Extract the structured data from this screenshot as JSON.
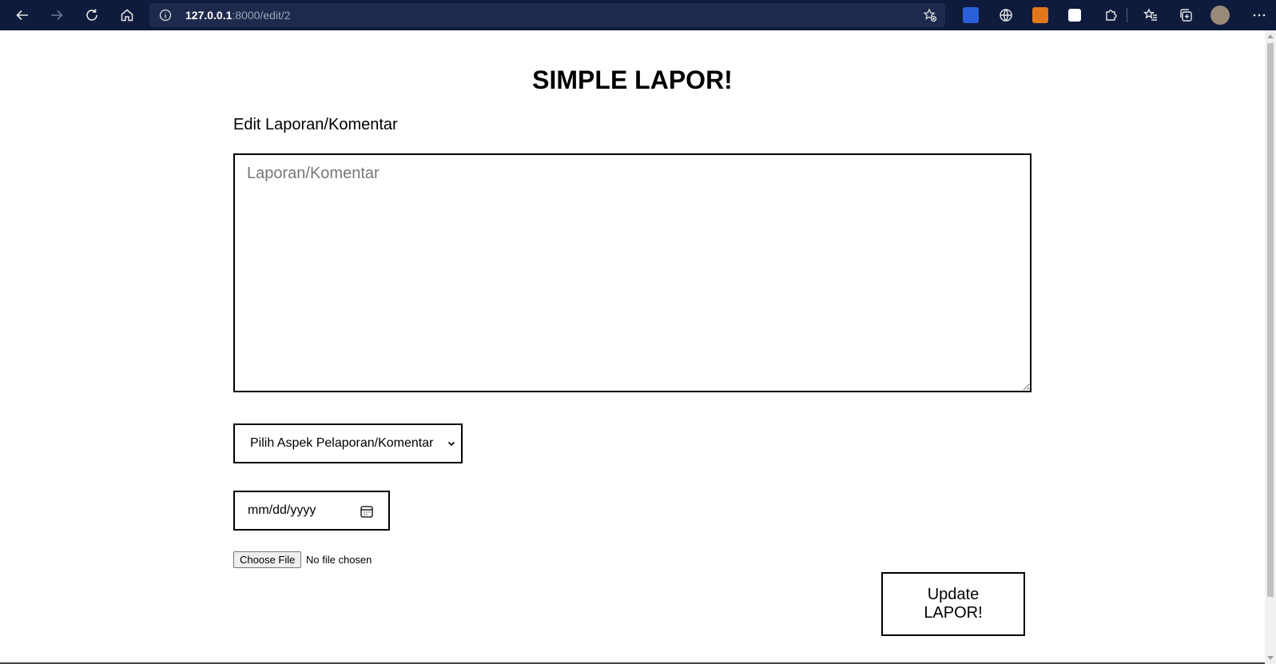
{
  "browser": {
    "url_host": "127.0.0.1",
    "url_rest": ":8000/edit/2",
    "icons": [
      "back-icon",
      "forward-icon",
      "reload-icon",
      "home-icon",
      "info-icon",
      "add-favorite-icon",
      "translate-extension-icon",
      "globe-extension-icon",
      "metamask-extension-icon",
      "bitwarden-extension-icon",
      "extensions-icon",
      "favorites-icon",
      "collections-icon",
      "profile-avatar",
      "more-menu-icon"
    ]
  },
  "page": {
    "title": "SIMPLE LAPOR!",
    "subtitle": "Edit Laporan/Komentar",
    "report_placeholder": "Laporan/Komentar",
    "aspect_select_value": "Pilih Aspek Pelaporan/Komentar",
    "date_placeholder": "mm/dd/yyyy",
    "file_button_label": "Choose File",
    "file_status": "No file chosen",
    "submit_label_line1": "Update",
    "submit_label_line2": "LAPOR!"
  },
  "colors": {
    "toolbar_bg": "#0f1b3d",
    "address_bg": "#1e2a4d",
    "border": "#000000"
  }
}
